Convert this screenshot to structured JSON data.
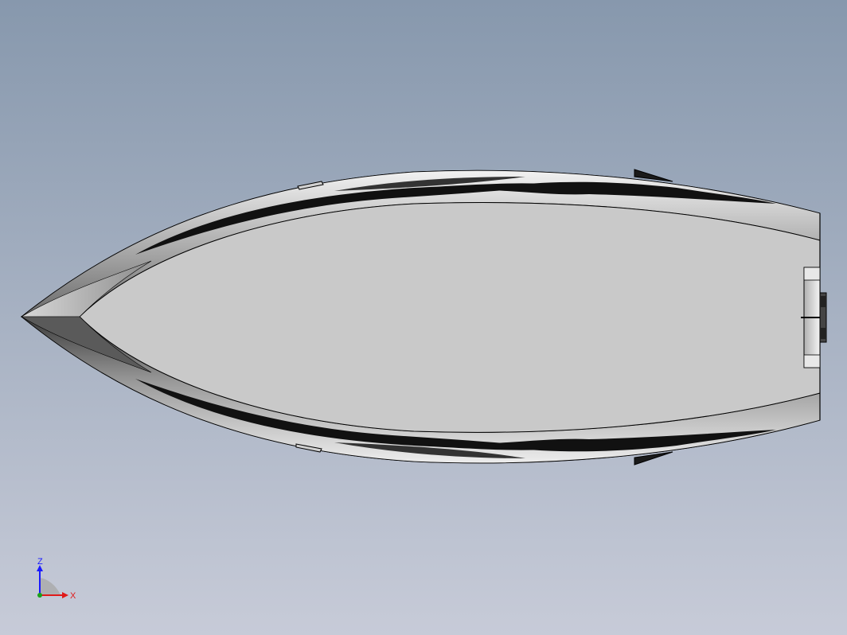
{
  "viewport": {
    "background_top": "#8798ad",
    "background_bottom": "#c7cbd8"
  },
  "model": {
    "deck_color": "#c9c9c9",
    "hull_light": "#e6e6e6",
    "hull_dark": "#1a1a1a",
    "edge_color": "#000000"
  },
  "triad": {
    "z_label": "Z",
    "x_label": "X",
    "z_color": "#1a1aff",
    "x_color": "#e01a1a",
    "y_color": "#1aa01a"
  }
}
